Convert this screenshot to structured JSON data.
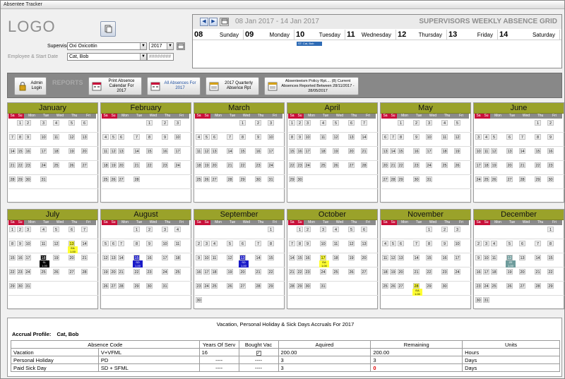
{
  "window": {
    "title": "Absentee Tracker"
  },
  "header": {
    "logo": "LOGO",
    "supervisor_label": "Supervisor",
    "supervisor_value": "Oxi Oxicottin",
    "year_value": "2017",
    "employee_label": "Employee & Start Date",
    "employee_value": "Cat, Bob",
    "start_date_value": "########"
  },
  "weekly": {
    "range": "08 Jan 2017 - 14 Jan 2017",
    "title": "SUPERVISORS WEEKLY ABSENCE GRID",
    "days": [
      {
        "num": "08",
        "name": "Sunday"
      },
      {
        "num": "09",
        "name": "Monday"
      },
      {
        "num": "10",
        "name": "Tuesday"
      },
      {
        "num": "11",
        "name": "Wednesday"
      },
      {
        "num": "12",
        "name": "Thursday"
      },
      {
        "num": "13",
        "name": "Friday"
      },
      {
        "num": "14",
        "name": "Saturday"
      }
    ],
    "event_label": "ST: Cat, Bob"
  },
  "toolbar": {
    "admin_login": "Admin Login",
    "reports_label": "REPORTS",
    "print_absence": "Print Absence Calendar For 2017",
    "all_absences": "All Absences For 2017",
    "quarterly": "2017 Quarterly Absence Rpt",
    "policy": "Absenteeism Policy Rpt.... (8) Current Absences Reported Between 28/11/2017 - 28/05/2017"
  },
  "calendar": {
    "dow": [
      "Sa",
      "Su",
      "Mon",
      "Tue",
      "Wed",
      "Thu",
      "Fri"
    ],
    "months": [
      {
        "name": "January",
        "start": 1,
        "days": 31
      },
      {
        "name": "February",
        "start": 4,
        "days": 28
      },
      {
        "name": "March",
        "start": 4,
        "days": 31
      },
      {
        "name": "April",
        "start": 0,
        "days": 30
      },
      {
        "name": "May",
        "start": 2,
        "days": 31
      },
      {
        "name": "June",
        "start": 5,
        "days": 30
      },
      {
        "name": "July",
        "start": 0,
        "days": 31
      },
      {
        "name": "August",
        "start": 3,
        "days": 31
      },
      {
        "name": "September",
        "start": 6,
        "days": 30
      },
      {
        "name": "October",
        "start": 1,
        "days": 31
      },
      {
        "name": "November",
        "start": 4,
        "days": 30
      },
      {
        "name": "December",
        "start": 6,
        "days": 31
      }
    ],
    "absences": [
      {
        "month": 6,
        "day": 13,
        "color": "yellow",
        "code": "EA",
        "amount": "1.00"
      },
      {
        "month": 6,
        "day": 18,
        "color": "black",
        "code": "SL",
        "amount": "1.00"
      },
      {
        "month": 7,
        "day": 15,
        "color": "blue",
        "code": "SD",
        "amount": "1.00"
      },
      {
        "month": 8,
        "day": 13,
        "color": "blue",
        "code": "SD",
        "amount": "1.00"
      },
      {
        "month": 9,
        "day": 17,
        "color": "yellow",
        "code": "EA",
        "amount": "1.00"
      },
      {
        "month": 10,
        "day": 28,
        "color": "yellow",
        "code": "EA",
        "amount": "1.00"
      },
      {
        "month": 11,
        "day": 12,
        "color": "teal",
        "code": "ZE",
        "amount": "1.00"
      }
    ]
  },
  "accruals": {
    "title": "Vacation, Personal Holiday & Sick Days Accruals For 2017",
    "profile_label": "Accrual Profile:",
    "profile_value": "Cat, Bob",
    "columns": [
      "Absence Code",
      "Years Of Serv",
      "Bought Vac",
      "Aquired",
      "Remaining",
      "Units"
    ],
    "rows": [
      {
        "name": "Vacation",
        "code": "V+VFML",
        "years": "16",
        "bought": "✓",
        "aquired": "200.00",
        "remaining": "200.00",
        "units": "Hours"
      },
      {
        "name": "Personal Holiday",
        "code": "PD",
        "years": "----",
        "bought": "----",
        "aquired": "3",
        "remaining": "3",
        "units": "Days"
      },
      {
        "name": "Paid Sick Day",
        "code": "SD + SFML",
        "years": "----",
        "bought": "----",
        "aquired": "3",
        "remaining": "0",
        "units": "Days"
      }
    ]
  }
}
